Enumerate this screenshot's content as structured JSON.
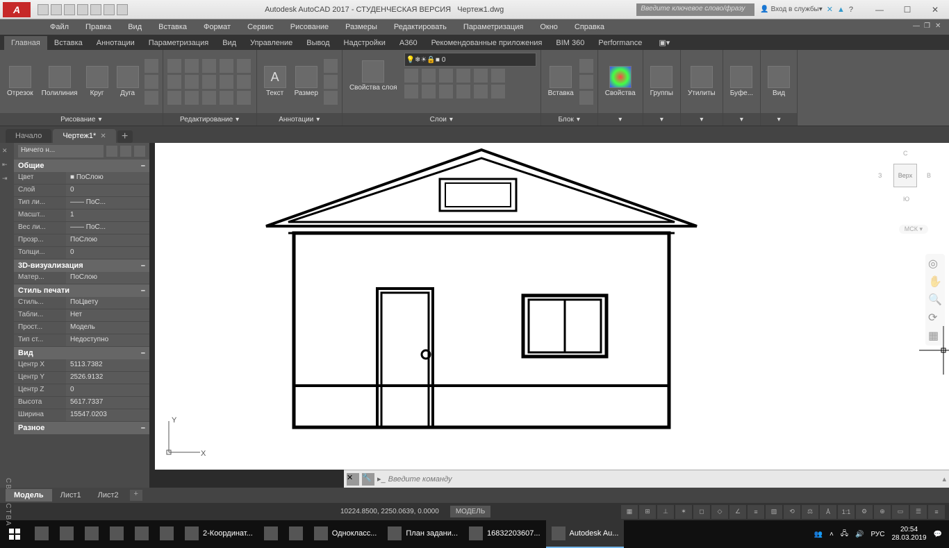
{
  "title": {
    "app": "Autodesk AutoCAD 2017 - СТУДЕНЧЕСКАЯ ВЕРСИЯ",
    "file": "Чертеж1.dwg",
    "search_placeholder": "Введите ключевое слово/фразу",
    "signin": "Вход в службы"
  },
  "menubar": [
    "Файл",
    "Правка",
    "Вид",
    "Вставка",
    "Формат",
    "Сервис",
    "Рисование",
    "Размеры",
    "Редактировать",
    "Параметризация",
    "Окно",
    "Справка"
  ],
  "ribtabs": [
    "Главная",
    "Вставка",
    "Аннотации",
    "Параметризация",
    "Вид",
    "Управление",
    "Вывод",
    "Надстройки",
    "A360",
    "Рекомендованные приложения",
    "BIM 360",
    "Performance"
  ],
  "ribbon": {
    "draw": {
      "title": "Рисование",
      "btns": [
        "Отрезок",
        "Полилиния",
        "Круг",
        "Дуга"
      ]
    },
    "modify": {
      "title": "Редактирование"
    },
    "annot": {
      "title": "Аннотации",
      "btns": [
        "Текст",
        "Размер"
      ]
    },
    "layers": {
      "title": "Слои",
      "current": "0",
      "props": "Свойства слоя"
    },
    "block": {
      "title": "Блок",
      "btn": "Вставка"
    },
    "props": {
      "title": "",
      "btn": "Свойства"
    },
    "groups": {
      "btn": "Группы"
    },
    "util": {
      "btn": "Утилиты"
    },
    "clip": {
      "btn": "Буфе..."
    },
    "view": {
      "btn": "Вид"
    }
  },
  "filetabs": {
    "start": "Начало",
    "active": "Чертеж1*"
  },
  "palette": {
    "selector": "Ничего н...",
    "cats": [
      {
        "name": "Общие",
        "rows": [
          {
            "k": "Цвет",
            "v": "■ ПоСлою"
          },
          {
            "k": "Слой",
            "v": "0"
          },
          {
            "k": "Тип ли...",
            "v": "—— ПоС..."
          },
          {
            "k": "Масшт...",
            "v": "1"
          },
          {
            "k": "Вес ли...",
            "v": "—— ПоС..."
          },
          {
            "k": "Прозр...",
            "v": "ПоСлою"
          },
          {
            "k": "Толщи...",
            "v": "0"
          }
        ]
      },
      {
        "name": "3D-визуализация",
        "rows": [
          {
            "k": "Матер...",
            "v": "ПоСлою"
          }
        ]
      },
      {
        "name": "Стиль печати",
        "rows": [
          {
            "k": "Стиль...",
            "v": "ПоЦвету"
          },
          {
            "k": "Табли...",
            "v": "Нет"
          },
          {
            "k": "Прост...",
            "v": "Модель"
          },
          {
            "k": "Тип ст...",
            "v": "Недоступно"
          }
        ]
      },
      {
        "name": "Вид",
        "rows": [
          {
            "k": "Центр X",
            "v": "5113.7382"
          },
          {
            "k": "Центр Y",
            "v": "2526.9132"
          },
          {
            "k": "Центр Z",
            "v": "0"
          },
          {
            "k": "Высота",
            "v": "5617.7337"
          },
          {
            "k": "Ширина",
            "v": "15547.0203"
          }
        ]
      },
      {
        "name": "Разное",
        "rows": []
      }
    ],
    "side": "СВОЙСТВА"
  },
  "viewcube": {
    "top": "Верх",
    "n": "С",
    "s": "Ю",
    "e": "В",
    "w": "З",
    "wcs": "МСК ▾"
  },
  "cmdline": {
    "placeholder": "Введите команду"
  },
  "layouts": [
    "Модель",
    "Лист1",
    "Лист2"
  ],
  "status": {
    "coords": "10224.8500, 2250.0639, 0.0000",
    "model": "МОДЕЛЬ",
    "scale": "1:1"
  },
  "taskbar": {
    "items": [
      {
        "label": "",
        "icon": "search"
      },
      {
        "label": "",
        "icon": "tasks"
      },
      {
        "label": "",
        "icon": "y"
      },
      {
        "label": "",
        "icon": "folder"
      },
      {
        "label": "",
        "icon": "opera"
      },
      {
        "label": "",
        "icon": "mail"
      },
      {
        "label": "2-Координат...",
        "icon": "edge"
      },
      {
        "label": "",
        "icon": "ya"
      },
      {
        "label": "",
        "icon": "yb"
      },
      {
        "label": "Однокласс...",
        "icon": "chrome"
      },
      {
        "label": "План задани...",
        "icon": "word"
      },
      {
        "label": "16832203607...",
        "icon": "word"
      },
      {
        "label": "Autodesk Au...",
        "icon": "acad",
        "active": true
      }
    ],
    "lang": "РУС",
    "time": "20:54",
    "date": "28.03.2019"
  }
}
